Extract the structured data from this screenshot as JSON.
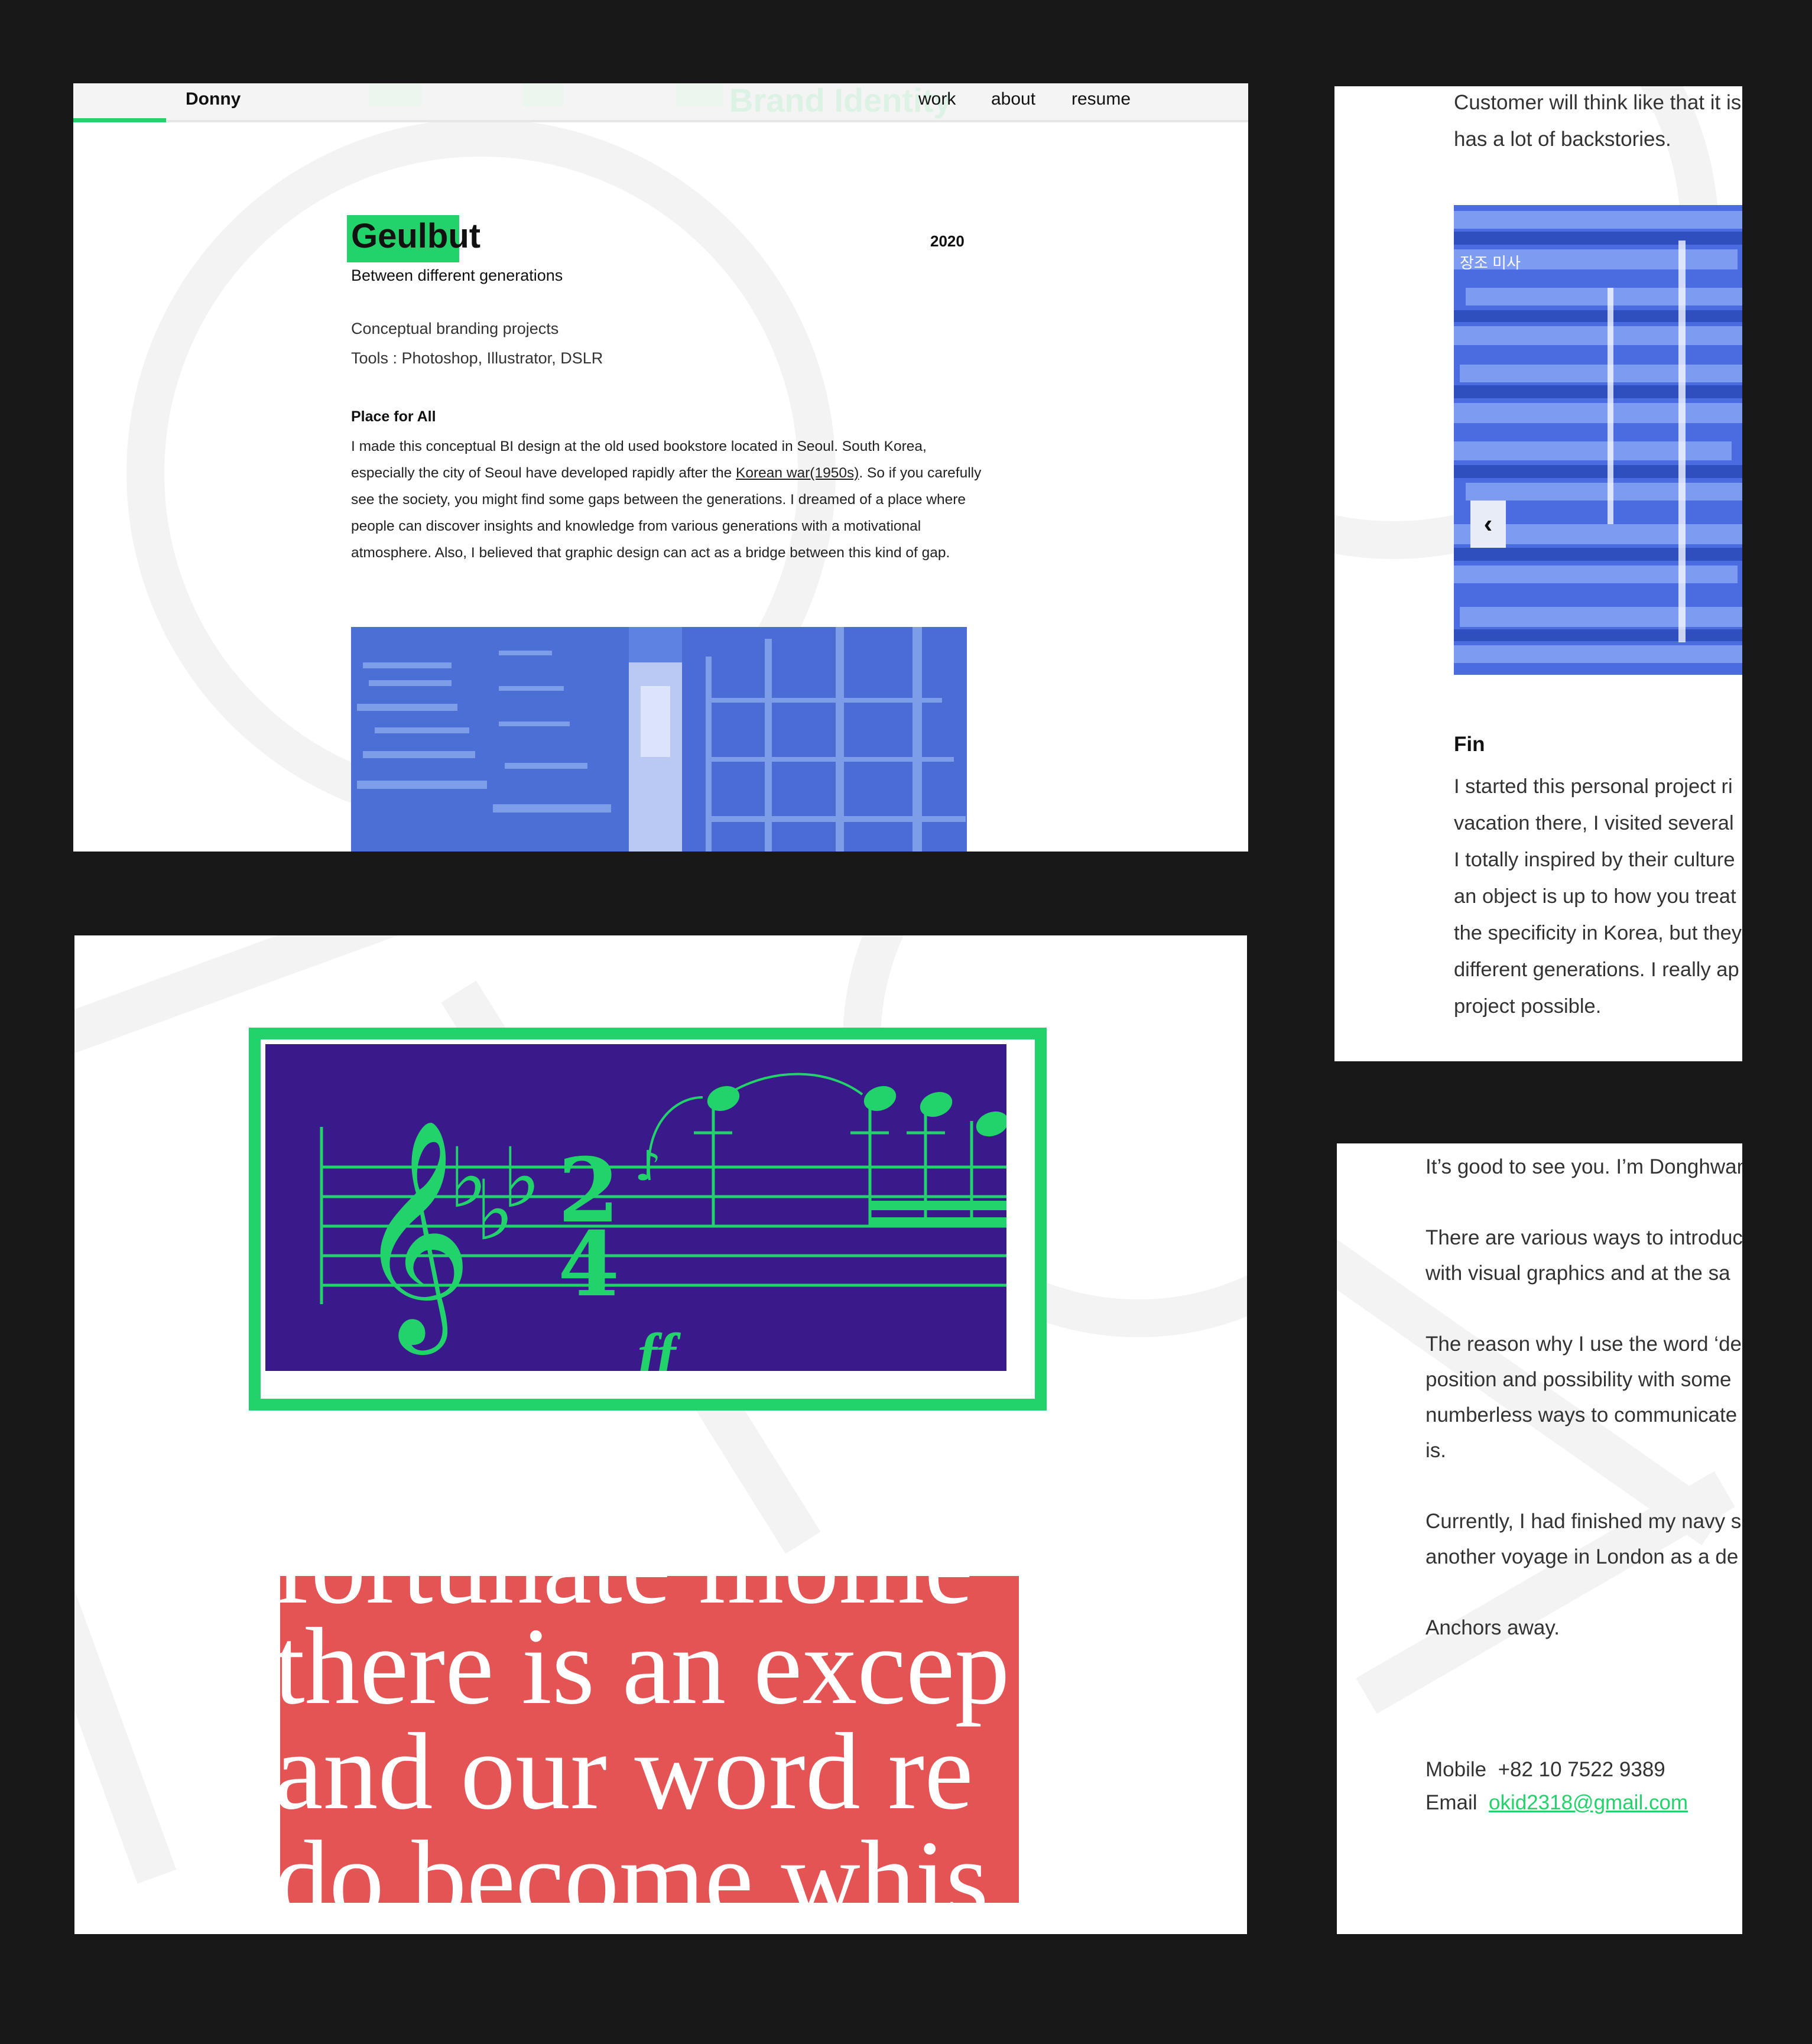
{
  "panel1": {
    "nav": {
      "brand": "Donny",
      "faded_heading": "Brand Identity",
      "menu": [
        "work",
        "about",
        "resume"
      ]
    },
    "project": {
      "title": "Geulbut",
      "year": "2020",
      "subtitle": "Between different generations",
      "meta_lines": [
        "Conceptual branding projects",
        "Tools : Photoshop, Illustrator, DSLR"
      ],
      "section_heading": "Place for All",
      "para_before_link": "I made this conceptual BI design at the old used bookstore located in Seoul. South Korea, especially the city of Seoul have developed rapidly after the ",
      "para_link": "Korean war(1950s)",
      "para_after_link": ". So if you carefully see the society, you might find some gaps between the generations. I dreamed of a place where people can discover insights and knowledge from various generations with a motivational atmosphere. Also, I believed that graphic design can act as a bridge between this kind of gap."
    },
    "carousel_next_icon": "chevron-right"
  },
  "panel2": {
    "intro_lines": [
      "Customer will think like that it is",
      "has a lot of backstories."
    ],
    "carousel_prev_icon": "chevron-left",
    "cassette_label": "장조 미사",
    "fin_heading": "Fin",
    "fin_lines": [
      "I started this personal project ri",
      "vacation there, I visited several",
      "I totally inspired by their culture",
      "an object is up to how you treat",
      "the specificity in Korea, but they",
      "different generations. I really ap",
      "project possible."
    ]
  },
  "panel3": {
    "music_dynamic": "ff",
    "red_text_lines": [
      "fortunate mome",
      "there is an excep",
      "and our word re",
      "do become whis"
    ]
  },
  "panel4": {
    "paragraphs": [
      [
        "It’s good to see you. I’m Donghwan"
      ],
      [
        "There are various ways to introduc",
        "with visual graphics and at the sa"
      ],
      [
        "The reason why I use the word ‘de",
        "position and possibility with some",
        "numberless ways to communicate",
        "is."
      ],
      [
        "Currently, I had finished my navy s",
        "another voyage in London as a de"
      ],
      [
        "Anchors away."
      ]
    ],
    "contact": {
      "mobile_label": "Mobile",
      "mobile_value": "+82 10 7522 9389",
      "email_label": "Email",
      "email_value": "okid2318@gmail.com"
    }
  },
  "colors": {
    "accent": "#22d36b",
    "background": "#181818",
    "photo_blue": "#5b7fe0",
    "music_purple": "#3a1a8a",
    "red_block": "#e55454"
  }
}
